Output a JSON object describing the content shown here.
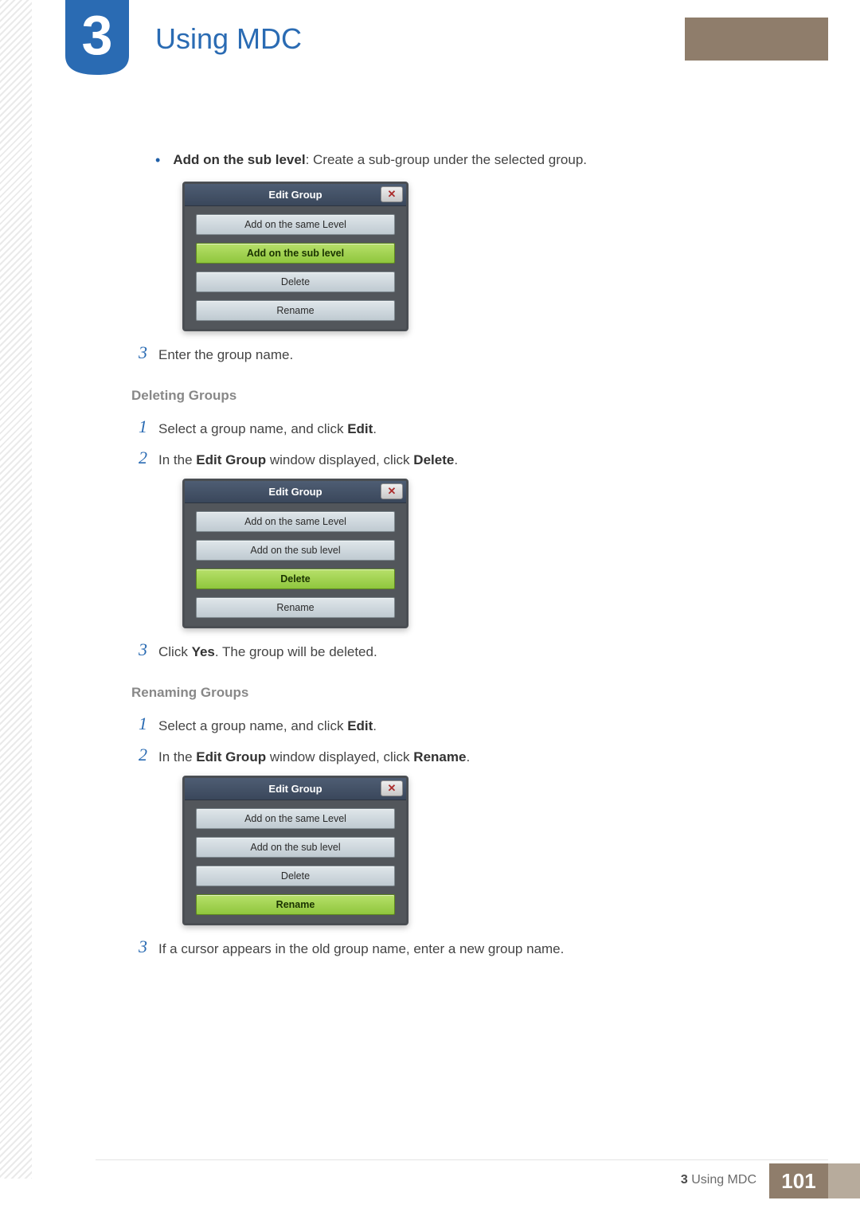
{
  "header": {
    "chapter_number": "3",
    "title": "Using MDC"
  },
  "intro_bullet": {
    "label": "Add on the sub level",
    "description": ": Create a sub-group under the selected group."
  },
  "dialog_common": {
    "title": "Edit Group",
    "close_glyph": "✕",
    "buttons": {
      "same": "Add on the same Level",
      "sub": "Add on the sub level",
      "delete": "Delete",
      "rename": "Rename"
    }
  },
  "after_dialog1_step": "Enter the group name.",
  "sections": {
    "deleting": {
      "heading": "Deleting Groups",
      "steps": {
        "s1_pre": "Select a group name, and click ",
        "s1_bold": "Edit",
        "s1_post": ".",
        "s2_pre": "In the ",
        "s2_bold1": "Edit Group",
        "s2_mid": " window displayed, click ",
        "s2_bold2": "Delete",
        "s2_post": ".",
        "s3_pre": "Click ",
        "s3_bold": "Yes",
        "s3_post": ". The group will be deleted."
      }
    },
    "renaming": {
      "heading": "Renaming Groups",
      "steps": {
        "s1_pre": "Select a group name, and click ",
        "s1_bold": "Edit",
        "s1_post": ".",
        "s2_pre": "In the ",
        "s2_bold1": "Edit Group",
        "s2_mid": " window displayed, click ",
        "s2_bold2": "Rename",
        "s2_post": ".",
        "s3": "If a cursor appears in the old group name, enter a new group name."
      }
    }
  },
  "footer": {
    "section_num": "3",
    "section_label": "Using MDC",
    "page_number": "101"
  }
}
